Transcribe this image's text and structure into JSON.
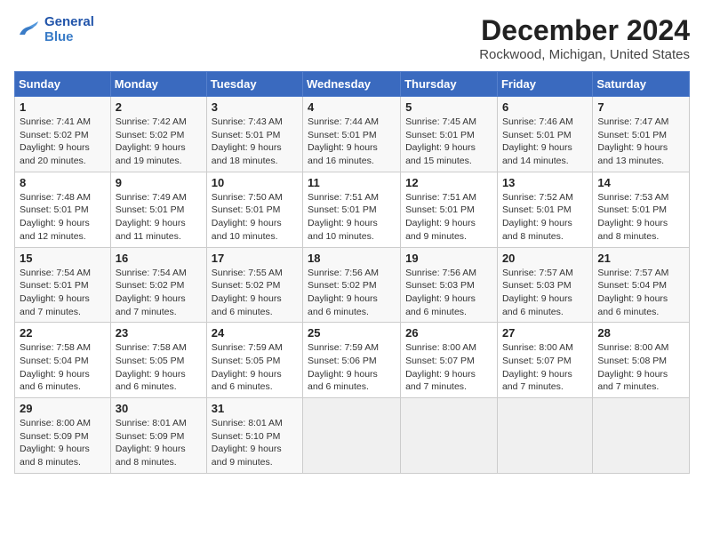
{
  "header": {
    "logo_line1": "General",
    "logo_line2": "Blue",
    "main_title": "December 2024",
    "subtitle": "Rockwood, Michigan, United States"
  },
  "weekdays": [
    "Sunday",
    "Monday",
    "Tuesday",
    "Wednesday",
    "Thursday",
    "Friday",
    "Saturday"
  ],
  "weeks": [
    [
      {
        "day": "1",
        "info": "Sunrise: 7:41 AM\nSunset: 5:02 PM\nDaylight: 9 hours\nand 20 minutes."
      },
      {
        "day": "2",
        "info": "Sunrise: 7:42 AM\nSunset: 5:02 PM\nDaylight: 9 hours\nand 19 minutes."
      },
      {
        "day": "3",
        "info": "Sunrise: 7:43 AM\nSunset: 5:01 PM\nDaylight: 9 hours\nand 18 minutes."
      },
      {
        "day": "4",
        "info": "Sunrise: 7:44 AM\nSunset: 5:01 PM\nDaylight: 9 hours\nand 16 minutes."
      },
      {
        "day": "5",
        "info": "Sunrise: 7:45 AM\nSunset: 5:01 PM\nDaylight: 9 hours\nand 15 minutes."
      },
      {
        "day": "6",
        "info": "Sunrise: 7:46 AM\nSunset: 5:01 PM\nDaylight: 9 hours\nand 14 minutes."
      },
      {
        "day": "7",
        "info": "Sunrise: 7:47 AM\nSunset: 5:01 PM\nDaylight: 9 hours\nand 13 minutes."
      }
    ],
    [
      {
        "day": "8",
        "info": "Sunrise: 7:48 AM\nSunset: 5:01 PM\nDaylight: 9 hours\nand 12 minutes."
      },
      {
        "day": "9",
        "info": "Sunrise: 7:49 AM\nSunset: 5:01 PM\nDaylight: 9 hours\nand 11 minutes."
      },
      {
        "day": "10",
        "info": "Sunrise: 7:50 AM\nSunset: 5:01 PM\nDaylight: 9 hours\nand 10 minutes."
      },
      {
        "day": "11",
        "info": "Sunrise: 7:51 AM\nSunset: 5:01 PM\nDaylight: 9 hours\nand 10 minutes."
      },
      {
        "day": "12",
        "info": "Sunrise: 7:51 AM\nSunset: 5:01 PM\nDaylight: 9 hours\nand 9 minutes."
      },
      {
        "day": "13",
        "info": "Sunrise: 7:52 AM\nSunset: 5:01 PM\nDaylight: 9 hours\nand 8 minutes."
      },
      {
        "day": "14",
        "info": "Sunrise: 7:53 AM\nSunset: 5:01 PM\nDaylight: 9 hours\nand 8 minutes."
      }
    ],
    [
      {
        "day": "15",
        "info": "Sunrise: 7:54 AM\nSunset: 5:01 PM\nDaylight: 9 hours\nand 7 minutes."
      },
      {
        "day": "16",
        "info": "Sunrise: 7:54 AM\nSunset: 5:02 PM\nDaylight: 9 hours\nand 7 minutes."
      },
      {
        "day": "17",
        "info": "Sunrise: 7:55 AM\nSunset: 5:02 PM\nDaylight: 9 hours\nand 6 minutes."
      },
      {
        "day": "18",
        "info": "Sunrise: 7:56 AM\nSunset: 5:02 PM\nDaylight: 9 hours\nand 6 minutes."
      },
      {
        "day": "19",
        "info": "Sunrise: 7:56 AM\nSunset: 5:03 PM\nDaylight: 9 hours\nand 6 minutes."
      },
      {
        "day": "20",
        "info": "Sunrise: 7:57 AM\nSunset: 5:03 PM\nDaylight: 9 hours\nand 6 minutes."
      },
      {
        "day": "21",
        "info": "Sunrise: 7:57 AM\nSunset: 5:04 PM\nDaylight: 9 hours\nand 6 minutes."
      }
    ],
    [
      {
        "day": "22",
        "info": "Sunrise: 7:58 AM\nSunset: 5:04 PM\nDaylight: 9 hours\nand 6 minutes."
      },
      {
        "day": "23",
        "info": "Sunrise: 7:58 AM\nSunset: 5:05 PM\nDaylight: 9 hours\nand 6 minutes."
      },
      {
        "day": "24",
        "info": "Sunrise: 7:59 AM\nSunset: 5:05 PM\nDaylight: 9 hours\nand 6 minutes."
      },
      {
        "day": "25",
        "info": "Sunrise: 7:59 AM\nSunset: 5:06 PM\nDaylight: 9 hours\nand 6 minutes."
      },
      {
        "day": "26",
        "info": "Sunrise: 8:00 AM\nSunset: 5:07 PM\nDaylight: 9 hours\nand 7 minutes."
      },
      {
        "day": "27",
        "info": "Sunrise: 8:00 AM\nSunset: 5:07 PM\nDaylight: 9 hours\nand 7 minutes."
      },
      {
        "day": "28",
        "info": "Sunrise: 8:00 AM\nSunset: 5:08 PM\nDaylight: 9 hours\nand 7 minutes."
      }
    ],
    [
      {
        "day": "29",
        "info": "Sunrise: 8:00 AM\nSunset: 5:09 PM\nDaylight: 9 hours\nand 8 minutes."
      },
      {
        "day": "30",
        "info": "Sunrise: 8:01 AM\nSunset: 5:09 PM\nDaylight: 9 hours\nand 8 minutes."
      },
      {
        "day": "31",
        "info": "Sunrise: 8:01 AM\nSunset: 5:10 PM\nDaylight: 9 hours\nand 9 minutes."
      },
      {
        "day": "",
        "info": ""
      },
      {
        "day": "",
        "info": ""
      },
      {
        "day": "",
        "info": ""
      },
      {
        "day": "",
        "info": ""
      }
    ]
  ]
}
